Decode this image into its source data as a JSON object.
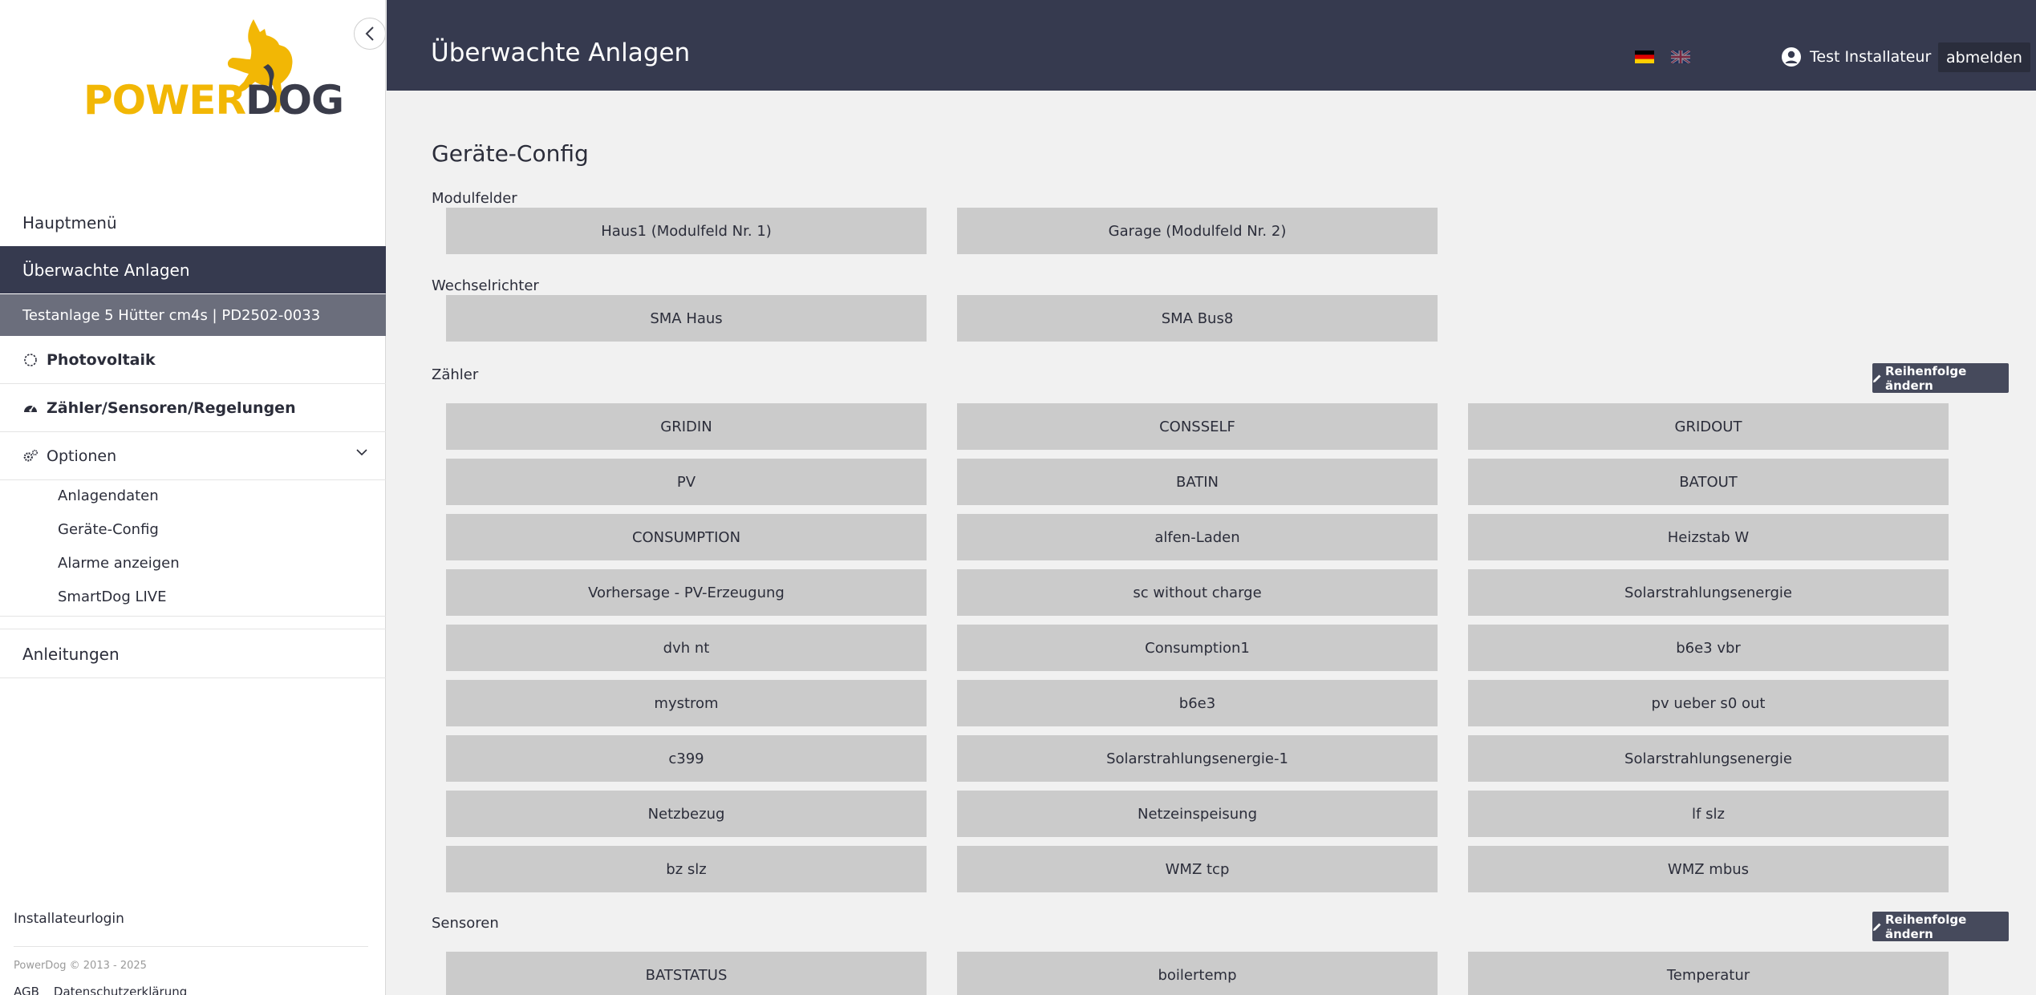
{
  "brand": {
    "logo_part1": "POWER",
    "logo_part2": "DOG"
  },
  "sidebar": {
    "hauptmenu": "Hauptmenü",
    "ueberwacht": "Überwachte Anlagen",
    "anlage": "Testanlage 5 Hütter cm4s | PD2502-0033",
    "photovoltaik": "Photovoltaik",
    "zaehler": "Zähler/Sensoren/Regelungen",
    "optionen": "Optionen",
    "optionen_items": [
      "Anlagendaten",
      "Geräte-Config",
      "Alarme anzeigen",
      "SmartDog LIVE"
    ],
    "anleitungen": "Anleitungen",
    "installateurlogin": "Installateurlogin",
    "copyright": "PowerDog © 2013 - 2025",
    "footer_links": [
      "AGB",
      "Datenschutzerklärung"
    ]
  },
  "header": {
    "title": "Überwachte Anlagen",
    "user": "Test Installateur",
    "logout": "abmelden"
  },
  "main": {
    "title": "Geräte-Config",
    "modulfelder_label": "Modulfelder",
    "modulfelder": [
      "Haus1 (Modulfeld Nr. 1)",
      "Garage (Modulfeld Nr. 2)"
    ],
    "wechselrichter_label": "Wechselrichter",
    "wechselrichter": [
      "SMA Haus",
      "SMA Bus8"
    ],
    "zaehler_label": "Zähler",
    "order_button": "Reihenfolge ändern",
    "zaehler": [
      "GRIDIN",
      "CONSSELF",
      "GRIDOUT",
      "PV",
      "BATIN",
      "BATOUT",
      "CONSUMPTION",
      "alfen-Laden",
      "Heizstab W",
      "Vorhersage - PV-Erzeugung",
      "sc without charge",
      "Solarstrahlungsenergie",
      "dvh nt",
      "Consumption1",
      "b6e3 vbr",
      "mystrom",
      "b6e3",
      "pv ueber s0 out",
      "c399",
      "Solarstrahlungsenergie-1",
      "Solarstrahlungsenergie",
      "Netzbezug",
      "Netzeinspeisung",
      "lf slz",
      "bz slz",
      "WMZ tcp",
      "WMZ mbus"
    ],
    "sensoren_label": "Sensoren",
    "sensoren": [
      "BATSTATUS",
      "boilertemp",
      "Temperatur"
    ]
  },
  "colors": {
    "header_bg": "#363a4f",
    "accent": "#f2b705",
    "tile_bg": "#cbcbcb",
    "active_nav": "#363a4f",
    "sub_active": "#6b6e7c"
  }
}
